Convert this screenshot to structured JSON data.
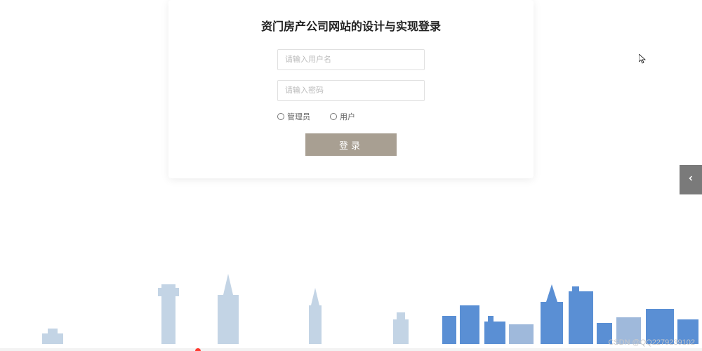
{
  "login": {
    "title": "资门房产公司网站的设计与实现登录",
    "username_placeholder": "请输入用户名",
    "password_placeholder": "请输入密码",
    "role_admin": "管理员",
    "role_user": "用户",
    "submit_label": "登录"
  },
  "watermark": "CSDN @QQ2279239102"
}
